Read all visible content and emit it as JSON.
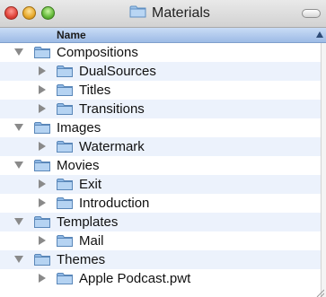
{
  "window": {
    "title": "Materials",
    "column_header": "Name",
    "sort_direction": "ascending"
  },
  "icons": {
    "folder": "folder-icon",
    "expanded": "triangle-down-icon",
    "collapsed": "triangle-right-icon"
  },
  "colors": {
    "header_gradient_top": "#c9dcf6",
    "header_gradient_bottom": "#9dbbe6",
    "row_alternate": "#ecf2fc",
    "close": "#e0443a",
    "minimize": "#e7a92b",
    "zoom": "#64b83a"
  },
  "tree": [
    {
      "label": "Compositions",
      "state": "expanded",
      "level": 0
    },
    {
      "label": "DualSources",
      "state": "collapsed",
      "level": 1
    },
    {
      "label": "Titles",
      "state": "collapsed",
      "level": 1
    },
    {
      "label": "Transitions",
      "state": "collapsed",
      "level": 1
    },
    {
      "label": "Images",
      "state": "expanded",
      "level": 0
    },
    {
      "label": "Watermark",
      "state": "collapsed",
      "level": 1
    },
    {
      "label": "Movies",
      "state": "expanded",
      "level": 0
    },
    {
      "label": "Exit",
      "state": "collapsed",
      "level": 1
    },
    {
      "label": "Introduction",
      "state": "collapsed",
      "level": 1
    },
    {
      "label": "Templates",
      "state": "expanded",
      "level": 0
    },
    {
      "label": "Mail",
      "state": "collapsed",
      "level": 1
    },
    {
      "label": "Themes",
      "state": "expanded",
      "level": 0
    },
    {
      "label": "Apple Podcast.pwt",
      "state": "collapsed",
      "level": 1
    }
  ]
}
